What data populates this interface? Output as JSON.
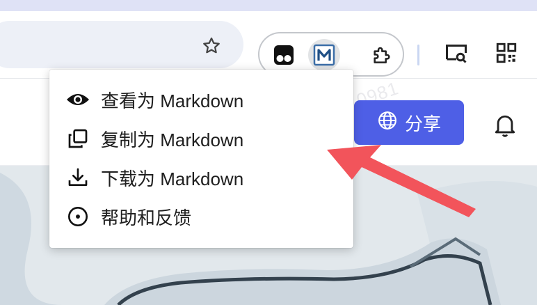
{
  "menu": {
    "items": [
      {
        "label": "查看为 Markdown",
        "icon": "eye-icon"
      },
      {
        "label": "复制为 Markdown",
        "icon": "copy-icon"
      },
      {
        "label": "下载为 Markdown",
        "icon": "download-icon"
      },
      {
        "label": "帮助和反馈",
        "icon": "help-circle-icon"
      }
    ]
  },
  "page": {
    "share_label": "分享",
    "watermark": "0981"
  },
  "colors": {
    "share_button": "#4e5fe6",
    "arrow": "#f2545b",
    "top_stripe": "#dfe2f6"
  },
  "toolbar": {
    "icons": [
      "star-icon",
      "tampermonkey-icon",
      "markdown-extension-icon",
      "extensions-puzzle-icon",
      "screen-search-icon",
      "qr-code-icon"
    ]
  }
}
